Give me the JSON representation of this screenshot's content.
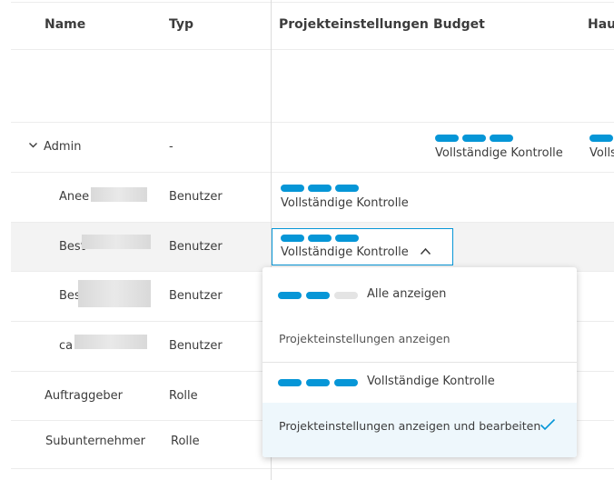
{
  "columns": [
    "Name",
    "Typ",
    "Projekteinstellungen",
    "Budget",
    "Hau"
  ],
  "rows": [
    {
      "name": "Admin",
      "type": "-",
      "projekt_level": "",
      "budget_level": "Vollständige Kontrolle",
      "hau_level": "Volls"
    },
    {
      "name": "Anee",
      "type": "Benutzer",
      "projekt_level": "Vollständige Kontrolle"
    },
    {
      "name": "Best",
      "type": "Benutzer",
      "projekt_level": "Vollständige Kontrolle"
    },
    {
      "name": "Bes",
      "type": "Benutzer"
    },
    {
      "name": "ca",
      "type": "Benutzer"
    },
    {
      "name": "Auftraggeber",
      "type": "Rolle"
    },
    {
      "name": "Subunternehmer",
      "type": "Rolle"
    }
  ],
  "icons": {
    "expand": "chevron-down-icon",
    "dropdown_toggle": "chevron-up-icon",
    "selected": "check-icon"
  },
  "accent_color": "#0696d7",
  "dropdown": {
    "options": [
      {
        "label": "Alle anzeigen",
        "description": "Projekteinstellungen anzeigen",
        "pills_filled": 2
      },
      {
        "label": "Vollständige Kontrolle",
        "description": "Projekteinstellungen anzeigen und bearbeiten",
        "pills_filled": 3,
        "selected": true
      }
    ]
  }
}
